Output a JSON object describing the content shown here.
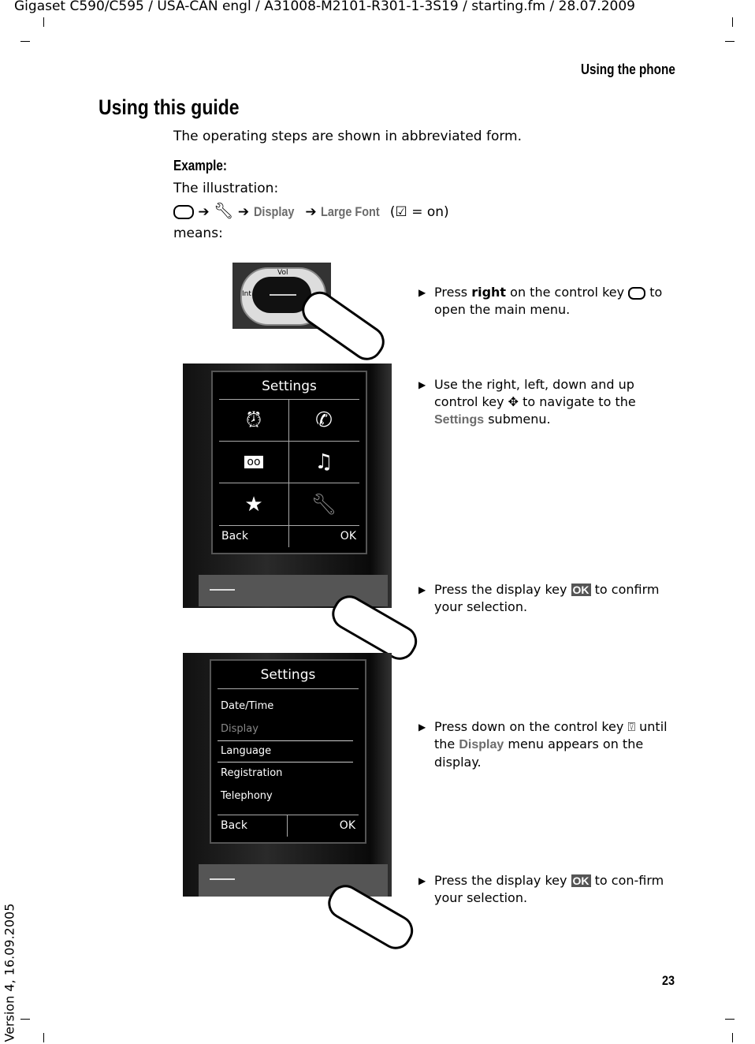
{
  "header": {
    "doc_info": "Gigaset C590/C595 / USA-CAN engl / A31008-M2101-R301-1-3S19 / starting.fm / 28.07.2009",
    "section": "Using the phone",
    "version": "Version 4, 16.09.2005",
    "page_number": "23"
  },
  "title": "Using this guide",
  "intro": "The operating steps are shown in abbreviated form.",
  "example_label": "Example:",
  "illustration_label": "The illustration:",
  "path": {
    "arrow": "➔",
    "step1": "Display",
    "step2": "Large Font",
    "paren_open": "(",
    "on_text": " = on)"
  },
  "means": "means:",
  "keypad": {
    "vol": "Vol",
    "int": "Int"
  },
  "screen1": {
    "title": "Settings",
    "icons": [
      "alarm-clock-icon",
      "call-transfer-icon",
      "voicemail-icon",
      "music-note-icon",
      "star-icon",
      "wrench-icon"
    ],
    "left_softkey": "Back",
    "right_softkey": "OK"
  },
  "screen2": {
    "title": "Settings",
    "items": [
      "Date/Time",
      "Display",
      "Language",
      "Registration",
      "Telephony"
    ],
    "selected": "Display",
    "left_softkey": "Back",
    "right_softkey": "OK"
  },
  "steps": [
    {
      "pre": "Press ",
      "bold": "right",
      "post": " on the control key ",
      "post2": " to open the main menu."
    },
    {
      "pre": "Use the right, left, down and up control key ",
      "mid": " to navigate to the ",
      "menu": "Settings",
      "post": " submenu."
    },
    {
      "pre": "Press the display key ",
      "key": "OK",
      "post": " to confirm your selection."
    },
    {
      "pre": "Press down on the control key ",
      "mid": " until the ",
      "menu": "Display",
      "post": " menu appears on the display."
    },
    {
      "pre": "Press the display key ",
      "key": "OK",
      "post": " to con-firm your selection."
    }
  ]
}
